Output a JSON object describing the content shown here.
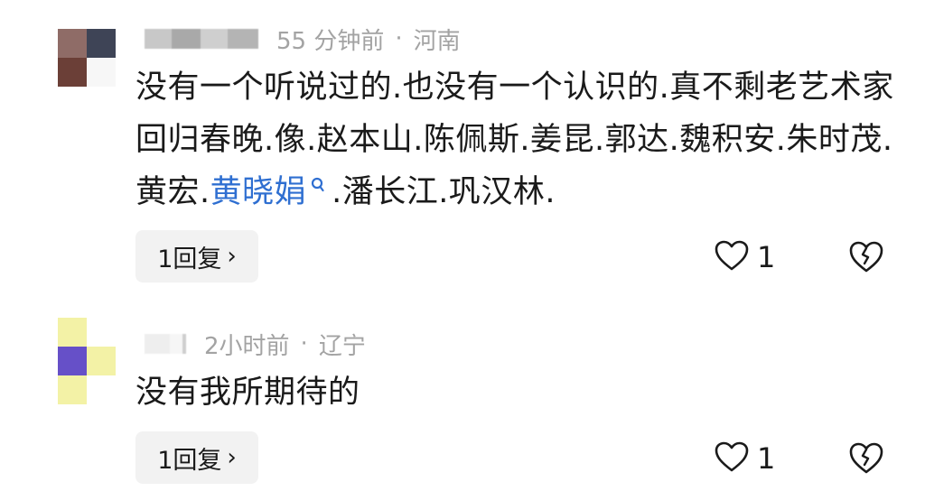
{
  "comments": [
    {
      "time": "55 分钟前",
      "separator": "·",
      "region": "河南",
      "text_before": "没有一个听说过的.也没有一个认识的.真不剩老艺术家回归春晚.像.赵本山.陈佩斯.姜昆.郭达.魏积安.朱时茂.黄宏.",
      "link_text": "黄晓娟",
      "text_after": ".潘长江.巩汉林.",
      "reply_label": "1回复",
      "reply_chevron": "›",
      "like_count": "1",
      "avatar_colors": [
        "#8f6c67",
        "#3e4456",
        "#6b3f37",
        "#f7f7f7"
      ]
    },
    {
      "time": "2小时前",
      "separator": "·",
      "region": "辽宁",
      "text": "没有我所期待的",
      "reply_label": "1回复",
      "reply_chevron": "›",
      "like_count": "1",
      "avatar_colors": [
        "#f3f2a6",
        "#ffffff",
        "#6650c8",
        "#f3f2a6"
      ]
    }
  ],
  "icons": {
    "like": "heart-outline-icon",
    "dislike": "broken-heart-icon",
    "search": "search-icon"
  },
  "colors": {
    "link": "#2f6fd1",
    "meta": "#a3a3a3",
    "reply_bg": "#f2f2f2"
  }
}
